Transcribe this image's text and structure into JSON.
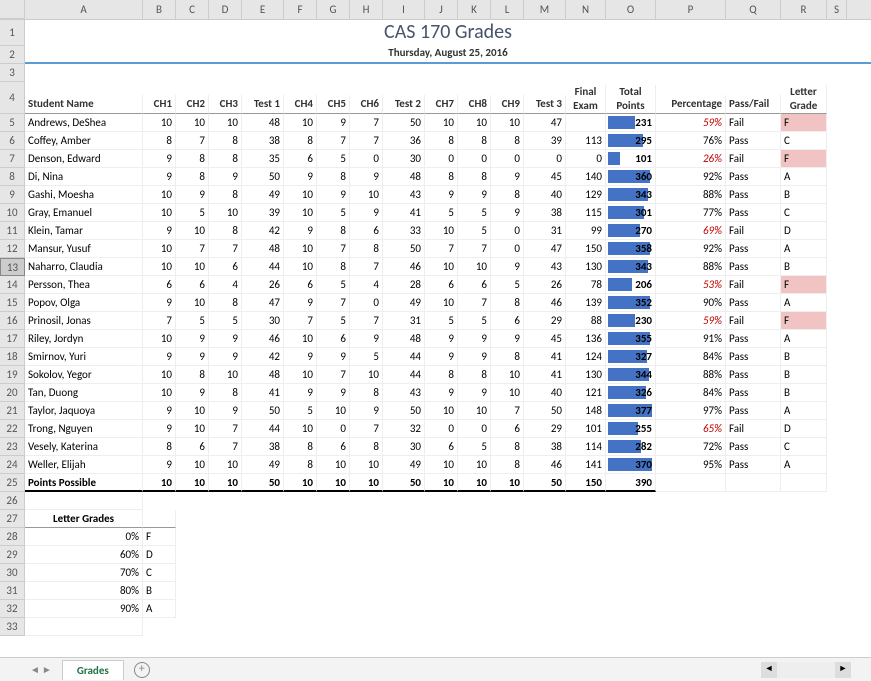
{
  "title": "CAS 170 Grades",
  "subtitle": "Thursday, August 25, 2016",
  "columns": [
    "A",
    "B",
    "C",
    "D",
    "E",
    "F",
    "G",
    "H",
    "I",
    "J",
    "K",
    "L",
    "M",
    "N",
    "O",
    "P",
    "Q",
    "R",
    "S"
  ],
  "headers": {
    "name": "Student Name",
    "ch1": "CH1",
    "ch2": "CH2",
    "ch3": "CH3",
    "test1": "Test 1",
    "ch4": "CH4",
    "ch5": "CH5",
    "ch6": "CH6",
    "test2": "Test 2",
    "ch7": "CH7",
    "ch8": "CH8",
    "ch9": "CH9",
    "test3": "Test 3",
    "final": "Final Exam",
    "points": "Total Points",
    "pct": "Percentage",
    "pf": "Pass/Fail",
    "grade": "Letter Grade"
  },
  "students": [
    {
      "name": "Andrews, DeShea",
      "ch1": 10,
      "ch2": 10,
      "ch3": 10,
      "t1": 48,
      "ch4": 10,
      "ch5": 9,
      "ch6": 7,
      "t2": 50,
      "ch7": 10,
      "ch8": 10,
      "ch9": 10,
      "t3": 47,
      "fe": "",
      "pts": 231,
      "pct": "59%",
      "pf": "Fail",
      "g": "F",
      "fail": true
    },
    {
      "name": "Coffey, Amber",
      "ch1": 8,
      "ch2": 7,
      "ch3": 8,
      "t1": 38,
      "ch4": 8,
      "ch5": 7,
      "ch6": 7,
      "t2": 36,
      "ch7": 8,
      "ch8": 8,
      "ch9": 8,
      "t3": 39,
      "fe": 113,
      "pts": 295,
      "pct": "76%",
      "pf": "Pass",
      "g": "C"
    },
    {
      "name": "Denson, Edward",
      "ch1": 9,
      "ch2": 8,
      "ch3": 8,
      "t1": 35,
      "ch4": 6,
      "ch5": 5,
      "ch6": 0,
      "t2": 30,
      "ch7": 0,
      "ch8": 0,
      "ch9": 0,
      "t3": 0,
      "fe": 0,
      "pts": 101,
      "pct": "26%",
      "pf": "Fail",
      "g": "F",
      "fail": true
    },
    {
      "name": "Di, Nina",
      "ch1": 9,
      "ch2": 8,
      "ch3": 9,
      "t1": 50,
      "ch4": 9,
      "ch5": 8,
      "ch6": 9,
      "t2": 48,
      "ch7": 8,
      "ch8": 8,
      "ch9": 9,
      "t3": 45,
      "fe": 140,
      "pts": 360,
      "pct": "92%",
      "pf": "Pass",
      "g": "A"
    },
    {
      "name": "Gashi, Moesha",
      "ch1": 10,
      "ch2": 9,
      "ch3": 8,
      "t1": 49,
      "ch4": 10,
      "ch5": 9,
      "ch6": 10,
      "t2": 43,
      "ch7": 9,
      "ch8": 9,
      "ch9": 8,
      "t3": 40,
      "fe": 129,
      "pts": 343,
      "pct": "88%",
      "pf": "Pass",
      "g": "B"
    },
    {
      "name": "Gray, Emanuel",
      "ch1": 10,
      "ch2": 5,
      "ch3": 10,
      "t1": 39,
      "ch4": 10,
      "ch5": 5,
      "ch6": 9,
      "t2": 41,
      "ch7": 5,
      "ch8": 5,
      "ch9": 9,
      "t3": 38,
      "fe": 115,
      "pts": 301,
      "pct": "77%",
      "pf": "Pass",
      "g": "C"
    },
    {
      "name": "Klein, Tamar",
      "ch1": 9,
      "ch2": 10,
      "ch3": 8,
      "t1": 42,
      "ch4": 9,
      "ch5": 8,
      "ch6": 6,
      "t2": 33,
      "ch7": 10,
      "ch8": 5,
      "ch9": 0,
      "t3": 31,
      "fe": 99,
      "pts": 270,
      "pct": "69%",
      "pf": "Fail",
      "g": "D",
      "failpct": true
    },
    {
      "name": "Mansur, Yusuf",
      "ch1": 10,
      "ch2": 7,
      "ch3": 7,
      "t1": 48,
      "ch4": 10,
      "ch5": 7,
      "ch6": 8,
      "t2": 50,
      "ch7": 7,
      "ch8": 7,
      "ch9": 0,
      "t3": 47,
      "fe": 150,
      "pts": 358,
      "pct": "92%",
      "pf": "Pass",
      "g": "A"
    },
    {
      "name": "Naharro, Claudia",
      "ch1": 10,
      "ch2": 10,
      "ch3": 6,
      "t1": 44,
      "ch4": 10,
      "ch5": 8,
      "ch6": 7,
      "t2": 46,
      "ch7": 10,
      "ch8": 10,
      "ch9": 9,
      "t3": 43,
      "fe": 130,
      "pts": 343,
      "pct": "88%",
      "pf": "Pass",
      "g": "B"
    },
    {
      "name": "Persson, Thea",
      "ch1": 6,
      "ch2": 6,
      "ch3": 4,
      "t1": 26,
      "ch4": 6,
      "ch5": 5,
      "ch6": 4,
      "t2": 28,
      "ch7": 6,
      "ch8": 6,
      "ch9": 5,
      "t3": 26,
      "fe": 78,
      "pts": 206,
      "pct": "53%",
      "pf": "Fail",
      "g": "F",
      "fail": true
    },
    {
      "name": "Popov, Olga",
      "ch1": 9,
      "ch2": 10,
      "ch3": 8,
      "t1": 47,
      "ch4": 9,
      "ch5": 7,
      "ch6": 0,
      "t2": 49,
      "ch7": 10,
      "ch8": 7,
      "ch9": 8,
      "t3": 46,
      "fe": 139,
      "pts": 352,
      "pct": "90%",
      "pf": "Pass",
      "g": "A"
    },
    {
      "name": "Prinosil, Jonas",
      "ch1": 7,
      "ch2": 5,
      "ch3": 5,
      "t1": 30,
      "ch4": 7,
      "ch5": 5,
      "ch6": 7,
      "t2": 31,
      "ch7": 5,
      "ch8": 5,
      "ch9": 6,
      "t3": 29,
      "fe": 88,
      "pts": 230,
      "pct": "59%",
      "pf": "Fail",
      "g": "F",
      "fail": true
    },
    {
      "name": "Riley, Jordyn",
      "ch1": 10,
      "ch2": 9,
      "ch3": 9,
      "t1": 46,
      "ch4": 10,
      "ch5": 6,
      "ch6": 9,
      "t2": 48,
      "ch7": 9,
      "ch8": 9,
      "ch9": 9,
      "t3": 45,
      "fe": 136,
      "pts": 355,
      "pct": "91%",
      "pf": "Pass",
      "g": "A"
    },
    {
      "name": "Smirnov, Yuri",
      "ch1": 9,
      "ch2": 9,
      "ch3": 9,
      "t1": 42,
      "ch4": 9,
      "ch5": 9,
      "ch6": 5,
      "t2": 44,
      "ch7": 9,
      "ch8": 9,
      "ch9": 8,
      "t3": 41,
      "fe": 124,
      "pts": 327,
      "pct": "84%",
      "pf": "Pass",
      "g": "B"
    },
    {
      "name": "Sokolov, Yegor",
      "ch1": 10,
      "ch2": 8,
      "ch3": 10,
      "t1": 48,
      "ch4": 10,
      "ch5": 7,
      "ch6": 10,
      "t2": 44,
      "ch7": 8,
      "ch8": 8,
      "ch9": 10,
      "t3": 41,
      "fe": 130,
      "pts": 344,
      "pct": "88%",
      "pf": "Pass",
      "g": "B"
    },
    {
      "name": "Tan, Duong",
      "ch1": 10,
      "ch2": 9,
      "ch3": 8,
      "t1": 41,
      "ch4": 9,
      "ch5": 9,
      "ch6": 8,
      "t2": 43,
      "ch7": 9,
      "ch8": 9,
      "ch9": 10,
      "t3": 40,
      "fe": 121,
      "pts": 326,
      "pct": "84%",
      "pf": "Pass",
      "g": "B"
    },
    {
      "name": "Taylor, Jaquoya",
      "ch1": 9,
      "ch2": 10,
      "ch3": 9,
      "t1": 50,
      "ch4": 5,
      "ch5": 10,
      "ch6": 9,
      "t2": 50,
      "ch7": 10,
      "ch8": 10,
      "ch9": 7,
      "t3": 50,
      "fe": 148,
      "pts": 377,
      "pct": "97%",
      "pf": "Pass",
      "g": "A"
    },
    {
      "name": "Trong, Nguyen",
      "ch1": 9,
      "ch2": 10,
      "ch3": 7,
      "t1": 44,
      "ch4": 10,
      "ch5": 0,
      "ch6": 7,
      "t2": 32,
      "ch7": 0,
      "ch8": 0,
      "ch9": 6,
      "t3": 29,
      "fe": 101,
      "pts": 255,
      "pct": "65%",
      "pf": "Fail",
      "g": "D",
      "failpct": true
    },
    {
      "name": "Vesely, Katerina",
      "ch1": 8,
      "ch2": 6,
      "ch3": 7,
      "t1": 38,
      "ch4": 8,
      "ch5": 6,
      "ch6": 8,
      "t2": 30,
      "ch7": 6,
      "ch8": 5,
      "ch9": 8,
      "t3": 38,
      "fe": 114,
      "pts": 282,
      "pct": "72%",
      "pf": "Pass",
      "g": "C"
    },
    {
      "name": "Weller, Elijah",
      "ch1": 9,
      "ch2": 10,
      "ch3": 10,
      "t1": 49,
      "ch4": 8,
      "ch5": 10,
      "ch6": 10,
      "t2": 49,
      "ch7": 10,
      "ch8": 10,
      "ch9": 8,
      "t3": 46,
      "fe": 141,
      "pts": 370,
      "pct": "95%",
      "pf": "Pass",
      "g": "A"
    }
  ],
  "possible": {
    "name": "Points Possible",
    "ch1": 10,
    "ch2": 10,
    "ch3": 10,
    "t1": 50,
    "ch4": 10,
    "ch5": 10,
    "ch6": 10,
    "t2": 50,
    "ch7": 10,
    "ch8": 10,
    "ch9": 10,
    "t3": 50,
    "fe": 150,
    "pts": 390
  },
  "maxPts": 390,
  "letterGrades": {
    "title": "Letter Grades",
    "rows": [
      {
        "pct": "0%",
        "g": "F"
      },
      {
        "pct": "60%",
        "g": "D"
      },
      {
        "pct": "70%",
        "g": "C"
      },
      {
        "pct": "80%",
        "g": "B"
      },
      {
        "pct": "90%",
        "g": "A"
      }
    ]
  },
  "sheetTab": "Grades",
  "selectedRow": 13
}
